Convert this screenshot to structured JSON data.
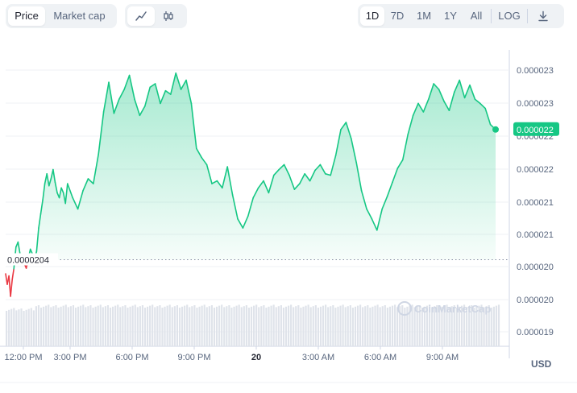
{
  "toolbar": {
    "metric_tabs": [
      {
        "label": "Price",
        "active": true
      },
      {
        "label": "Market cap",
        "active": false
      }
    ],
    "chart_style_tabs": [
      {
        "icon": "line-chart-icon",
        "active": true
      },
      {
        "icon": "candlestick-icon",
        "active": false
      }
    ],
    "range_tabs": [
      {
        "label": "1D",
        "active": true
      },
      {
        "label": "7D",
        "active": false
      },
      {
        "label": "1M",
        "active": false
      },
      {
        "label": "1Y",
        "active": false
      },
      {
        "label": "All",
        "active": false
      }
    ],
    "log_label": "LOG",
    "download_icon": "download-icon"
  },
  "currency_label": "USD",
  "watermark": "CoinMarketCap",
  "colors": {
    "up": "#16c784",
    "down": "#ea3943",
    "grid": "#eff2f5",
    "text": "#58667e"
  },
  "chart_data": {
    "type": "area",
    "x_tick_labels": [
      "12:00 PM",
      "3:00 PM",
      "6:00 PM",
      "9:00 PM",
      "20",
      "3:00 AM",
      "6:00 AM",
      "9:00 AM"
    ],
    "y_tick_labels": [
      "0.000023",
      "0.000023",
      "0.000022",
      "0.000022",
      "0.000021",
      "0.000021",
      "0.000020",
      "0.000020",
      "0.000019"
    ],
    "ylim": [
      1.917e-05,
      2.338e-05
    ],
    "open_price_label": "0.0000204",
    "open_price": 2.04e-05,
    "current_price_label": "0.000022",
    "current_price": 2.225e-05,
    "grid": true,
    "series": [
      {
        "hours": [
          0.0,
          0.08,
          0.16,
          0.24,
          0.32,
          0.4,
          0.5,
          0.6,
          0.7,
          0.8,
          0.9,
          1.0,
          1.1,
          1.2,
          1.3,
          1.4,
          1.5,
          1.6,
          1.7,
          1.8,
          1.9,
          2.0,
          2.1,
          2.2,
          2.3,
          2.4,
          2.5,
          2.6,
          2.7,
          2.8,
          2.9,
          3.0,
          3.25,
          3.5,
          3.75,
          4.0,
          4.25,
          4.5,
          4.75,
          5.0,
          5.25,
          5.5,
          5.75,
          6.0,
          6.25,
          6.5,
          6.75,
          7.0,
          7.25,
          7.5,
          7.75,
          8.0,
          8.25,
          8.5,
          8.75,
          9.0,
          9.25,
          9.5,
          9.75,
          10.0,
          10.25,
          10.5,
          10.75,
          11.0,
          11.25,
          11.5,
          11.75,
          12.0,
          12.25,
          12.5,
          12.75,
          13.0,
          13.25,
          13.5,
          13.75,
          14.0,
          14.25,
          14.5,
          14.75,
          15.0,
          15.25,
          15.5,
          15.75,
          16.0,
          16.25,
          16.5,
          16.75,
          17.0,
          17.25,
          17.5,
          17.75,
          18.0,
          18.25,
          18.5,
          18.75,
          19.0,
          19.25,
          19.5,
          19.75,
          20.0,
          20.25,
          20.5,
          20.75,
          21.0,
          21.25,
          21.5,
          21.75,
          22.0,
          22.25,
          22.5,
          22.75,
          23.0,
          23.25,
          23.5,
          23.75
        ],
        "values": [
          2.02e-05,
          2.005e-05,
          2.017e-05,
          1.988e-05,
          2.012e-05,
          2.027e-05,
          2.058e-05,
          2.065e-05,
          2.048e-05,
          2.041e-05,
          2.035e-05,
          2.028e-05,
          2.042e-05,
          2.055e-05,
          2.048e-05,
          2.04e-05,
          2.052e-05,
          2.085e-05,
          2.105e-05,
          2.125e-05,
          2.148e-05,
          2.162e-05,
          2.145e-05,
          2.155e-05,
          2.168e-05,
          2.15e-05,
          2.135e-05,
          2.128e-05,
          2.142e-05,
          2.135e-05,
          2.12e-05,
          2.148e-05,
          2.128e-05,
          2.112e-05,
          2.138e-05,
          2.155e-05,
          2.148e-05,
          2.19e-05,
          2.25e-05,
          2.292e-05,
          2.248e-05,
          2.268e-05,
          2.282e-05,
          2.302e-05,
          2.268e-05,
          2.245e-05,
          2.258e-05,
          2.285e-05,
          2.29e-05,
          2.262e-05,
          2.28e-05,
          2.275e-05,
          2.305e-05,
          2.282e-05,
          2.295e-05,
          2.262e-05,
          2.198e-05,
          2.185e-05,
          2.175e-05,
          2.148e-05,
          2.152e-05,
          2.142e-05,
          2.172e-05,
          2.132e-05,
          2.098e-05,
          2.085e-05,
          2.102e-05,
          2.128e-05,
          2.142e-05,
          2.152e-05,
          2.135e-05,
          2.16e-05,
          2.168e-05,
          2.175e-05,
          2.16e-05,
          2.14e-05,
          2.148e-05,
          2.162e-05,
          2.152e-05,
          2.167e-05,
          2.175e-05,
          2.162e-05,
          2.16e-05,
          2.188e-05,
          2.225e-05,
          2.235e-05,
          2.212e-05,
          2.178e-05,
          2.138e-05,
          2.112e-05,
          2.098e-05,
          2.082e-05,
          2.112e-05,
          2.13e-05,
          2.15e-05,
          2.17e-05,
          2.182e-05,
          2.218e-05,
          2.245e-05,
          2.262e-05,
          2.25e-05,
          2.268e-05,
          2.29e-05,
          2.282e-05,
          2.265e-05,
          2.252e-05,
          2.278e-05,
          2.295e-05,
          2.27e-05,
          2.288e-05,
          2.268e-05,
          2.262e-05,
          2.255e-05,
          2.232e-05,
          2.225e-05
        ]
      }
    ],
    "volume_bars": 200
  }
}
